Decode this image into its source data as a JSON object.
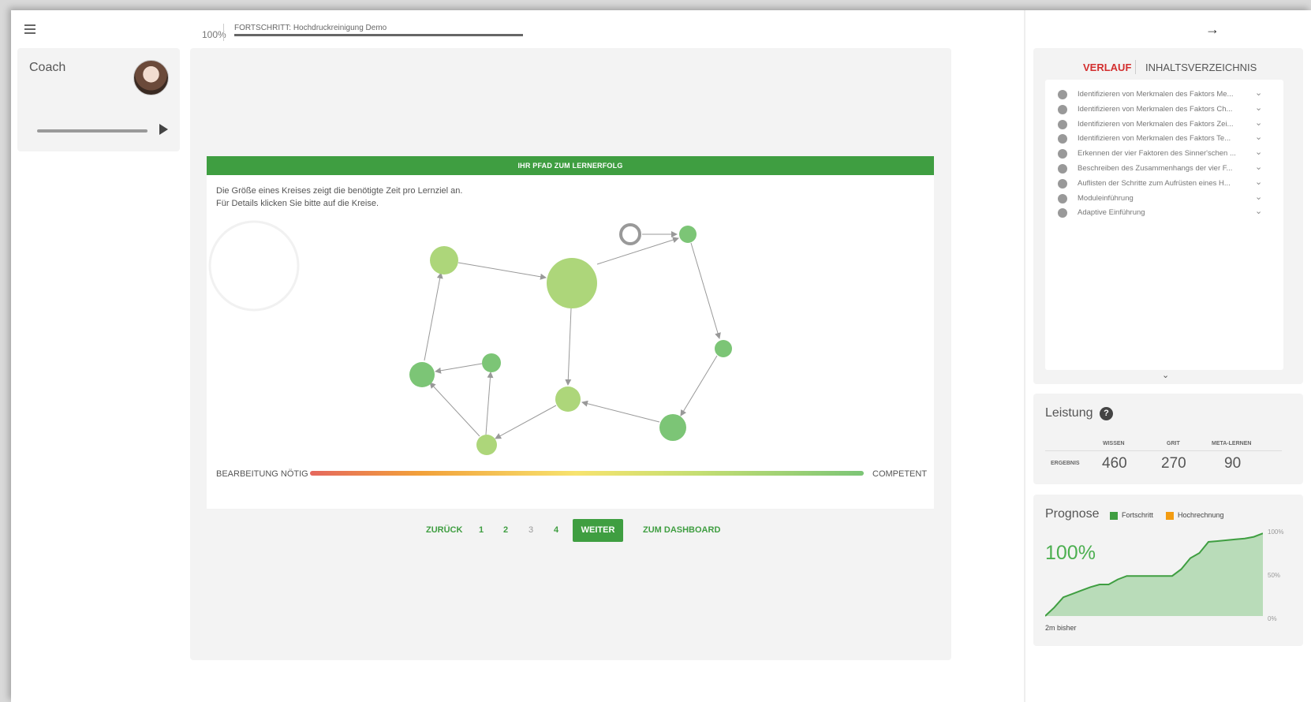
{
  "header": {
    "percent": "100%",
    "progress_label": "FORTSCHRITT: Hochdruckreinigung Demo",
    "progress_fraction": 1.0
  },
  "coach": {
    "title": "Coach"
  },
  "path": {
    "header": "IHR PFAD ZUM LERNERFOLG",
    "desc_line1": "Die Größe eines Kreises zeigt die benötigte Zeit pro Lernziel an.",
    "desc_line2": "Für Details klicken Sie bitte auf die Kreise.",
    "legend_left": "BEARBEITUNG NÖTIG",
    "legend_right": "COMPETENT"
  },
  "pager": {
    "back": "ZURÜCK",
    "pages": [
      "1",
      "2",
      "3",
      "4"
    ],
    "next": "WEITER",
    "dashboard": "ZUM DASHBOARD"
  },
  "sidebar": {
    "tab_active": "VERLAUF",
    "tab_other": "INHALTSVERZEICHNIS",
    "items": [
      "Identifizieren von Merkmalen des Faktors Me...",
      "Identifizieren von Merkmalen des Faktors Ch...",
      "Identifizieren von Merkmalen des Faktors Zei...",
      "Identifizieren von Merkmalen des Faktors Te...",
      "Erkennen der vier Faktoren des Sinner'schen ...",
      "Beschreiben des Zusammenhangs der vier F...",
      "Auflisten der Schritte zum Aufrüsten eines H...",
      "Moduleinführung",
      "Adaptive Einführung"
    ]
  },
  "performance": {
    "title": "Leistung",
    "help": "?",
    "cols": [
      "WISSEN",
      "GRIT",
      "META-LERNEN"
    ],
    "row_label": "ERGEBNIS",
    "values": [
      "460",
      "270",
      "90"
    ]
  },
  "forecast": {
    "title": "Prognose",
    "legend": [
      {
        "label": "Fortschritt",
        "color": "#3f9e41"
      },
      {
        "label": "Hochrechnung",
        "color": "#f39c12"
      }
    ],
    "big": "100%",
    "footer": "2m bisher",
    "axis": [
      "100%",
      "50%",
      "0%"
    ]
  },
  "chart_data": {
    "type": "area",
    "y": [
      0,
      10,
      22,
      26,
      30,
      34,
      37,
      37,
      43,
      47,
      47,
      47,
      47,
      47,
      47,
      55,
      68,
      74,
      87,
      88,
      89,
      90,
      91,
      93,
      97
    ],
    "ylim": [
      0,
      100
    ],
    "series": [
      {
        "name": "Fortschritt",
        "color": "#3f9e41"
      }
    ]
  },
  "icons": {
    "menu": "hamburger-menu-icon",
    "arrow": "arrow-right-icon",
    "play": "play-icon",
    "chevron": "chevron-down-icon"
  }
}
